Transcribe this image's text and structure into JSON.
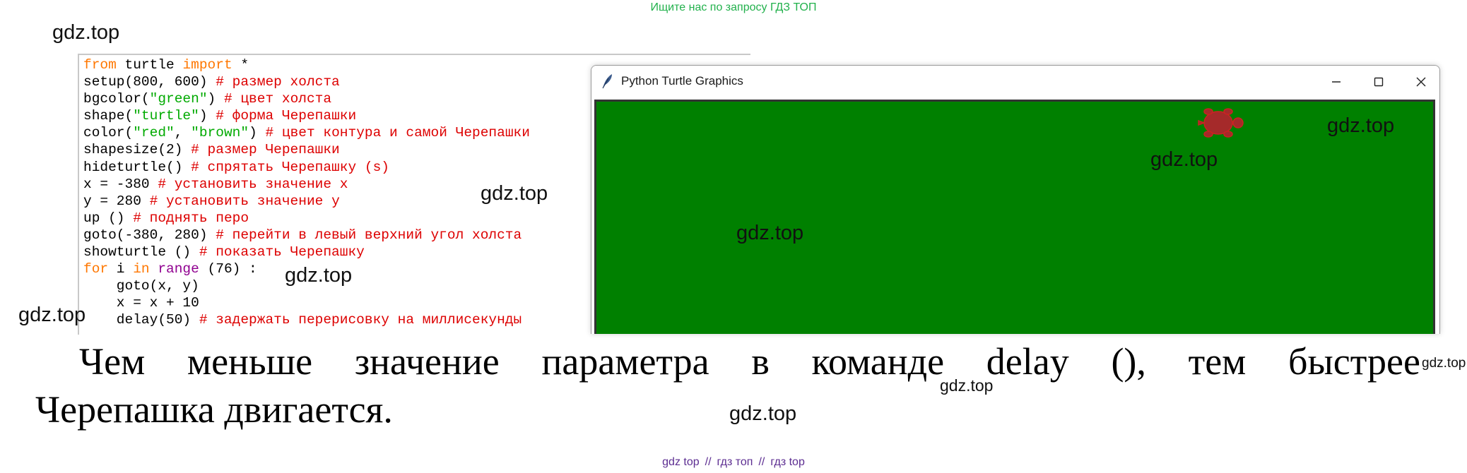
{
  "banner": "Ищите нас по запросу ГДЗ ТОП",
  "watermark": "gdz.top",
  "editor": {
    "lines": [
      [
        {
          "t": "from",
          "c": "kw"
        },
        {
          "t": " turtle ",
          "c": ""
        },
        {
          "t": "import",
          "c": "kw"
        },
        {
          "t": " *",
          "c": ""
        }
      ],
      [
        {
          "t": "setup(800, 600) ",
          "c": ""
        },
        {
          "t": "# размер холста",
          "c": "cm"
        }
      ],
      [
        {
          "t": "bgcolor(",
          "c": ""
        },
        {
          "t": "\"green\"",
          "c": "str"
        },
        {
          "t": ") ",
          "c": ""
        },
        {
          "t": "# цвет холста",
          "c": "cm"
        }
      ],
      [
        {
          "t": "shape(",
          "c": ""
        },
        {
          "t": "\"turtle\"",
          "c": "str"
        },
        {
          "t": ") ",
          "c": ""
        },
        {
          "t": "# форма Черепашки",
          "c": "cm"
        }
      ],
      [
        {
          "t": "color(",
          "c": ""
        },
        {
          "t": "\"red\"",
          "c": "str"
        },
        {
          "t": ", ",
          "c": ""
        },
        {
          "t": "\"brown\"",
          "c": "str"
        },
        {
          "t": ") ",
          "c": ""
        },
        {
          "t": "# цвет контура и самой Черепашки",
          "c": "cm"
        }
      ],
      [
        {
          "t": "shapesize(2) ",
          "c": ""
        },
        {
          "t": "# размер Черепашки",
          "c": "cm"
        }
      ],
      [
        {
          "t": "hideturtle() ",
          "c": ""
        },
        {
          "t": "# спрятать Черепашку (s)",
          "c": "cm"
        }
      ],
      [
        {
          "t": "x = -380 ",
          "c": ""
        },
        {
          "t": "# установить значение x",
          "c": "cm"
        }
      ],
      [
        {
          "t": "y = 280 ",
          "c": ""
        },
        {
          "t": "# установить значение y",
          "c": "cm"
        }
      ],
      [
        {
          "t": "up () ",
          "c": ""
        },
        {
          "t": "# поднять перо",
          "c": "cm"
        }
      ],
      [
        {
          "t": "goto(-380, 280) ",
          "c": ""
        },
        {
          "t": "# перейти в левый верхний угол холста",
          "c": "cm"
        }
      ],
      [
        {
          "t": "showturtle () ",
          "c": ""
        },
        {
          "t": "# показать Черепашку",
          "c": "cm"
        }
      ],
      [
        {
          "t": "for",
          "c": "kw"
        },
        {
          "t": " i ",
          "c": ""
        },
        {
          "t": "in",
          "c": "kw"
        },
        {
          "t": " ",
          "c": ""
        },
        {
          "t": "range",
          "c": "bi"
        },
        {
          "t": " (76) :",
          "c": ""
        }
      ],
      [
        {
          "t": "    goto(x, y)",
          "c": ""
        }
      ],
      [
        {
          "t": "    x = x + 10",
          "c": ""
        }
      ],
      [
        {
          "t": "    delay(50) ",
          "c": ""
        },
        {
          "t": "# задержать перерисовку на миллисекунды",
          "c": "cm"
        }
      ]
    ]
  },
  "turtle_window": {
    "title": "Python Turtle Graphics",
    "icon": "feather-icon",
    "canvas_color": "#008000",
    "turtle_color": "#a52a2a"
  },
  "answer": {
    "line1_words": [
      "Чем",
      "меньше",
      "значение",
      "параметра",
      "в",
      "команде",
      "delay",
      "(),",
      "тем",
      "быстрее"
    ],
    "line2": "Черепашка двигается."
  },
  "footer": [
    "gdz top",
    "//",
    "гдз топ",
    "//",
    "гдз top"
  ]
}
